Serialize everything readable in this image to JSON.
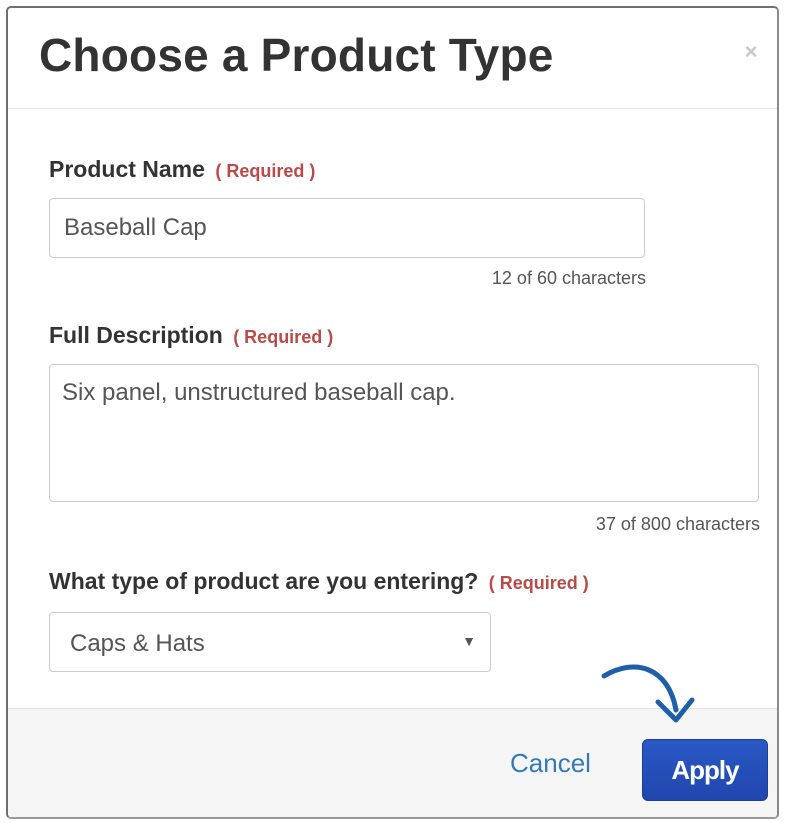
{
  "modal": {
    "title": "Choose a Product Type",
    "close_icon": "close-icon"
  },
  "fields": {
    "product_name": {
      "label": "Product Name",
      "required": "( Required )",
      "value": "Baseball Cap",
      "counter": "12 of 60 characters"
    },
    "full_description": {
      "label": "Full Description",
      "required": "( Required )",
      "value": "Six panel, unstructured baseball cap.",
      "counter": "37 of 800 characters"
    },
    "product_type": {
      "label": "What type of product are you entering?",
      "required": "( Required )",
      "selected": "Caps & Hats",
      "caret": "▼"
    }
  },
  "footer": {
    "cancel_label": "Cancel",
    "apply_label": "Apply"
  },
  "annotation": {
    "arrow_icon": "curved-arrow-icon",
    "arrow_color": "#1f5fa8"
  },
  "colors": {
    "required": "#b94a48",
    "link": "#337ab7",
    "primary_button": "#2450b8"
  }
}
